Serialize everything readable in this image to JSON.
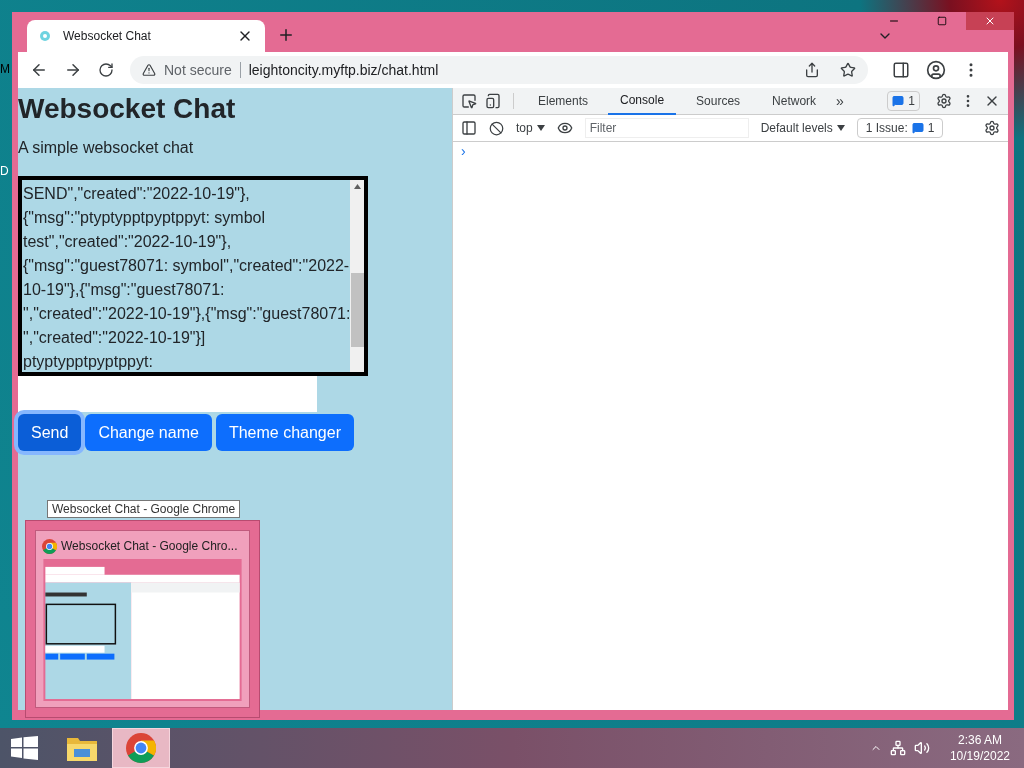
{
  "desktop_labels": [
    "M",
    "D"
  ],
  "browser": {
    "tab_title": "Websocket Chat",
    "security": "Not secure",
    "url": "leightoncity.myftp.biz/chat.html"
  },
  "page": {
    "heading": "Websocket Chat",
    "subtitle": "A simple websocket chat",
    "log_lines": [
      "SEND\",\"created\":\"2022-10-19\"},",
      "{\"msg\":\"ptyptypptpyptppyt: symbol",
      "test\",\"created\":\"2022-10-19\"},",
      "{\"msg\":\"guest78071: symbol\",\"created\":\"2022-",
      "10-19\"},{\"msg\":\"guest78071:",
      "\",\"created\":\"2022-10-19\"},{\"msg\":\"guest78071:",
      "\",\"created\":\"2022-10-19\"}]",
      "ptyptypptpyptppyt:"
    ],
    "buttons": [
      {
        "label": "Send",
        "focused": true
      },
      {
        "label": "Change name",
        "focused": false
      },
      {
        "label": "Theme changer",
        "focused": false
      }
    ]
  },
  "devtools": {
    "tabs": [
      {
        "label": "Elements",
        "selected": false
      },
      {
        "label": "Console",
        "selected": true
      },
      {
        "label": "Sources",
        "selected": false
      },
      {
        "label": "Network",
        "selected": false
      }
    ],
    "more": "»",
    "messages_badge": "1",
    "context": "top",
    "filter_placeholder": "Filter",
    "levels": "Default levels",
    "issues_label": "1 Issue:",
    "issues_count": "1",
    "prompt": "›"
  },
  "preview": {
    "tooltip": "Websocket Chat - Google Chrome",
    "title": "Websocket Chat - Google Chro..."
  },
  "taskbar": {
    "apps": [
      {
        "kind": "explorer",
        "selected": false
      },
      {
        "kind": "chrome",
        "selected": true
      }
    ],
    "time": "2:36 AM",
    "date": "10/19/2022"
  }
}
